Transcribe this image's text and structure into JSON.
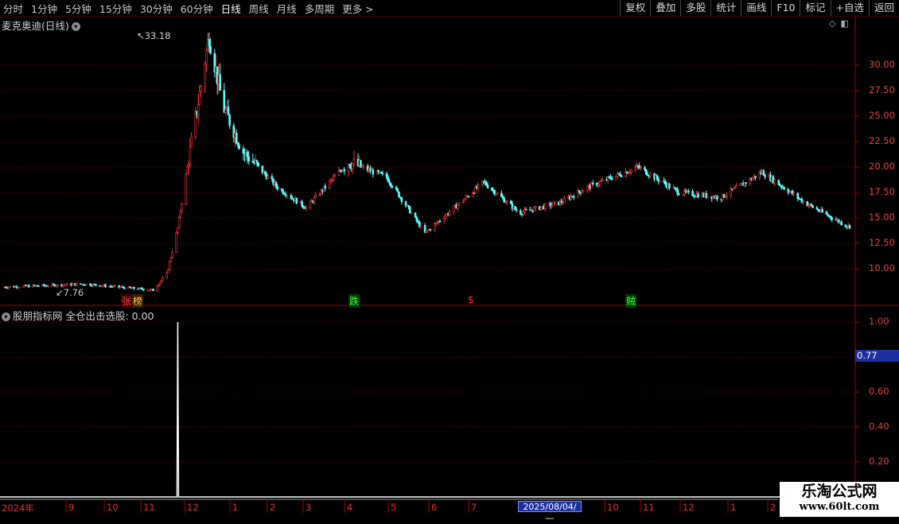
{
  "toolbar": {
    "periods": [
      "分时",
      "1分钟",
      "5分钟",
      "15分钟",
      "30分钟",
      "60分钟",
      "日线",
      "周线",
      "月线",
      "多周期",
      "更多 >"
    ],
    "active_period": "日线",
    "buttons": [
      "复权",
      "叠加",
      "多股",
      "统计",
      "画线",
      "F10",
      "标记",
      "+自选",
      "返回"
    ]
  },
  "main": {
    "title": "麦克奥迪(日线)",
    "high_label": "33.18",
    "low_label": "7.76",
    "signals": [
      {
        "text": "张",
        "color": "#ff4040",
        "bg": "#3a0000"
      },
      {
        "text": "榜",
        "color": "#ffd040",
        "bg": "#3a1a00"
      },
      {
        "text": "跌",
        "color": "#40ff40",
        "bg": "#003a00"
      },
      {
        "text": "$",
        "color": "#ff3030",
        "bg": ""
      },
      {
        "text": "贼",
        "color": "#40ff40",
        "bg": "#003a00"
      }
    ]
  },
  "indicator": {
    "title": "股朋指标网 全仓出击选股: 0.00",
    "cursor_value": "0.77"
  },
  "date_axis": {
    "cursor_date": "2025/08/04/—"
  },
  "watermark": {
    "line1": "乐淘公式网",
    "line2": "www.60lt.com"
  },
  "chart_data": [
    {
      "type": "candlestick",
      "title": "麦克奥迪(日线)",
      "y_ticks": [
        10.0,
        12.5,
        15.0,
        17.5,
        20.0,
        22.5,
        25.0,
        27.5,
        30.0
      ],
      "ylim": [
        7.0,
        34.0
      ],
      "grid": true,
      "annotations": [
        {
          "label": "33.18",
          "type": "max"
        },
        {
          "label": "7.76",
          "type": "min"
        }
      ],
      "approx_close_path": [
        [
          "2024-06",
          8.2
        ],
        [
          "2024-08",
          8.5
        ],
        [
          "2024-09-20",
          7.9
        ],
        [
          "2024-09-30",
          9.5
        ],
        [
          "2024-10-08",
          14.0
        ],
        [
          "2024-10-15",
          20.0
        ],
        [
          "2024-10-25",
          28.0
        ],
        [
          "2024-10-31",
          33.0
        ],
        [
          "2024-11-10",
          26.0
        ],
        [
          "2024-11-25",
          21.5
        ],
        [
          "2024-12-20",
          18.0
        ],
        [
          "2025-01-10",
          16.0
        ],
        [
          "2025-02-10",
          20.5
        ],
        [
          "2025-03-10",
          19.0
        ],
        [
          "2025-04-07",
          13.5
        ],
        [
          "2025-04-20",
          15.0
        ],
        [
          "2025-05-20",
          18.5
        ],
        [
          "2025-06-15",
          15.5
        ],
        [
          "2025-07-15",
          16.5
        ],
        [
          "2025-08-04",
          18.0
        ],
        [
          "2025-09-10",
          20.0
        ],
        [
          "2025-10-10",
          17.5
        ],
        [
          "2025-11-10",
          17.0
        ],
        [
          "2025-12-10",
          19.5
        ],
        [
          "2026-01-10",
          16.5
        ],
        [
          "2026-02-10",
          14.2
        ]
      ]
    },
    {
      "type": "line",
      "title": "股朋指标网 全仓出击选股",
      "y_ticks": [
        0.2,
        0.4,
        0.6,
        0.8,
        1.0
      ],
      "ylim": [
        0.0,
        1.05
      ],
      "series": [
        {
          "values_note": "0 everywhere except a spike to 1.00 at 2024-10-08"
        }
      ],
      "spike": {
        "date": "2024-10-08",
        "value": 1.0
      }
    }
  ],
  "x_axis": {
    "tick_labels": [
      "2024年",
      "9",
      "10",
      "11",
      "12",
      "1",
      "2",
      "3",
      "4",
      "5",
      "6",
      "7",
      "10",
      "11",
      "12",
      "1",
      "2"
    ]
  }
}
